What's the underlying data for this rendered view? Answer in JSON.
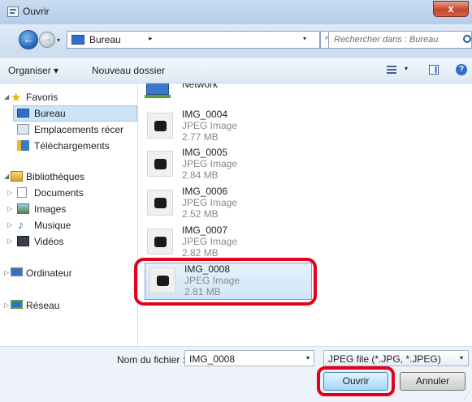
{
  "window": {
    "title": "Ouvrir",
    "close_label": "x"
  },
  "navigation": {
    "back_glyph": "←",
    "forward_glyph": "→",
    "address": {
      "location": "Bureau",
      "separator": "▸",
      "dropdown_glyph": "▾",
      "refresh_glyph": "↷"
    },
    "search_placeholder": "Rechercher dans : Bureau"
  },
  "toolbar": {
    "organize_label": "Organiser ▾",
    "new_folder_label": "Nouveau dossier",
    "view_dropdown_glyph": "▾",
    "help_glyph": "?"
  },
  "sidebar": {
    "favorites": {
      "label": "Favoris",
      "items": [
        {
          "label": "Bureau",
          "icon": "desktop-icon",
          "selected": true
        },
        {
          "label": "Emplacements récer",
          "icon": "recent-places-icon"
        },
        {
          "label": "Téléchargements",
          "icon": "downloads-icon"
        }
      ]
    },
    "libraries": {
      "label": "Bibliothèques",
      "items": [
        {
          "label": "Documents",
          "icon": "documents-icon"
        },
        {
          "label": "Images",
          "icon": "images-icon"
        },
        {
          "label": "Musique",
          "icon": "music-icon"
        },
        {
          "label": "Vidéos",
          "icon": "videos-icon"
        }
      ]
    },
    "computer_label": "Ordinateur",
    "network_label": "Réseau"
  },
  "files": {
    "network_partial_label": "Network",
    "items": [
      {
        "name": "IMG_0004",
        "type": "JPEG Image",
        "size": "2.77 MB"
      },
      {
        "name": "IMG_0005",
        "type": "JPEG Image",
        "size": "2.84 MB"
      },
      {
        "name": "IMG_0006",
        "type": "JPEG Image",
        "size": "2.52 MB"
      },
      {
        "name": "IMG_0007",
        "type": "JPEG Image",
        "size": "2.82 MB"
      },
      {
        "name": "IMG_0008",
        "type": "JPEG Image",
        "size": "2.81 MB",
        "selected": true
      }
    ]
  },
  "footer": {
    "filename_label": "Nom du fichier :",
    "filename_value": "IMG_0008",
    "filetype_value": "JPEG file (*.JPG, *.JPEG)",
    "dropdown_glyph": "▾",
    "open_label": "Ouvrir",
    "cancel_label": "Annuler"
  },
  "colors": {
    "highlight": "#e3001b",
    "selection": "#cce4f7",
    "accent": "#2f6fc9"
  }
}
